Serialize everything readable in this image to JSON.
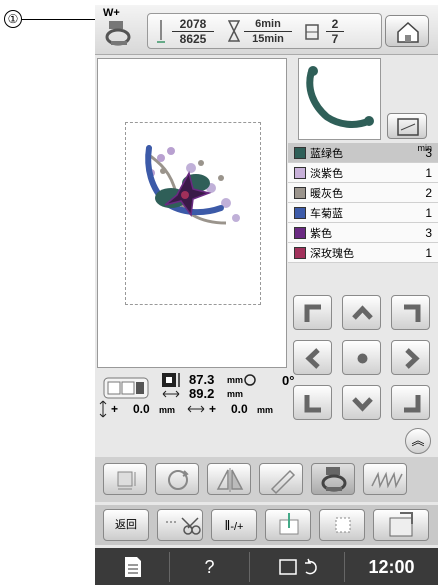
{
  "callout": {
    "number": "①"
  },
  "topbar": {
    "presser_foot_label": "W+",
    "stitch_current": "2078",
    "stitch_total": "8625",
    "time_current": "6min",
    "time_total": "15min",
    "color_current": "2",
    "color_total": "7",
    "home_icon": "home-icon"
  },
  "colors": {
    "header_unit": "min",
    "items": [
      {
        "name": "蓝绿色",
        "count": "3",
        "hex": "#2f5f58"
      },
      {
        "name": "淡紫色",
        "count": "1",
        "hex": "#c7b0d8"
      },
      {
        "name": "暖灰色",
        "count": "2",
        "hex": "#9a948c"
      },
      {
        "name": "车菊蓝",
        "count": "1",
        "hex": "#3c5aa8"
      },
      {
        "name": "紫色",
        "count": "3",
        "hex": "#6a2a82"
      },
      {
        "name": "深玫瑰色",
        "count": "1",
        "hex": "#a0305a"
      }
    ]
  },
  "info": {
    "width": "87.3",
    "height": "89.2",
    "unit": "mm",
    "angle": "0°",
    "offset_y_label": "+",
    "offset_y": "0.0",
    "offset_x_label": "+",
    "offset_x": "0.0"
  },
  "bottom": {
    "back_label": "返回",
    "stitch_label": "-/+"
  },
  "status": {
    "time": "12:00",
    "help": "?"
  }
}
